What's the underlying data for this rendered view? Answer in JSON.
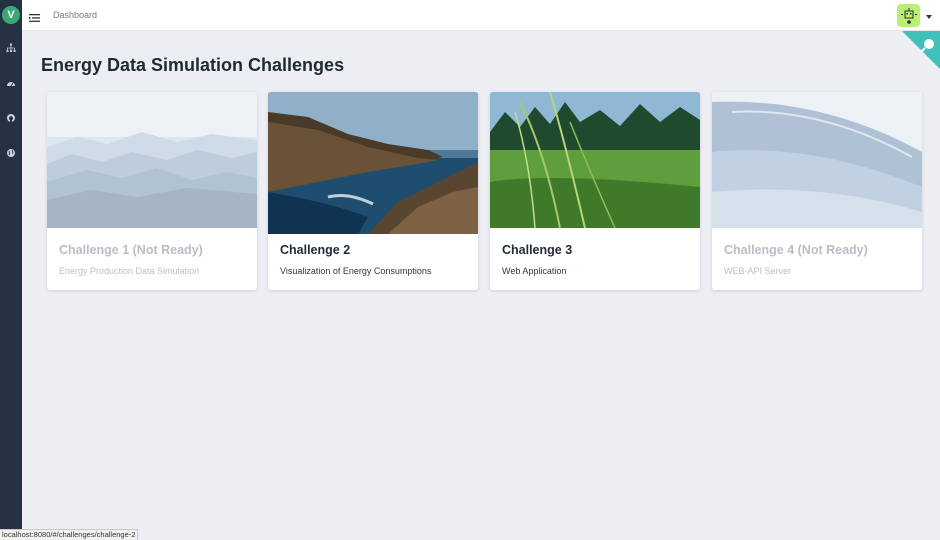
{
  "sidebar": {
    "logo_letter": "V",
    "items": [
      {
        "icon": "sitemap-icon"
      },
      {
        "icon": "dashboard-icon"
      },
      {
        "icon": "github-icon"
      },
      {
        "icon": "globe-icon"
      }
    ]
  },
  "topbar": {
    "breadcrumb": "Dashboard",
    "avatar_icon": "robot-avatar-icon"
  },
  "main": {
    "title": "Energy Data Simulation Challenges",
    "cards": [
      {
        "title": "Challenge 1 (Not Ready)",
        "subtitle": "Energy Production Data Simulation",
        "image": "misty-mountains",
        "ready": false
      },
      {
        "title": "Challenge 2",
        "subtitle": "Visualization of Energy Consumptions",
        "image": "rocky-coast",
        "ready": true
      },
      {
        "title": "Challenge 3",
        "subtitle": "Web Application",
        "image": "grass-field",
        "ready": true
      },
      {
        "title": "Challenge 4 (Not Ready)",
        "subtitle": "WEB-API Server",
        "image": "water-wave",
        "ready": false
      }
    ]
  },
  "status_bar": {
    "url": "localhost:8080/#/challenges/challenge-2"
  },
  "colors": {
    "sidebar": "#243243",
    "accent": "#3aa876",
    "corner": "#40c0b8",
    "background": "#eceef3"
  }
}
